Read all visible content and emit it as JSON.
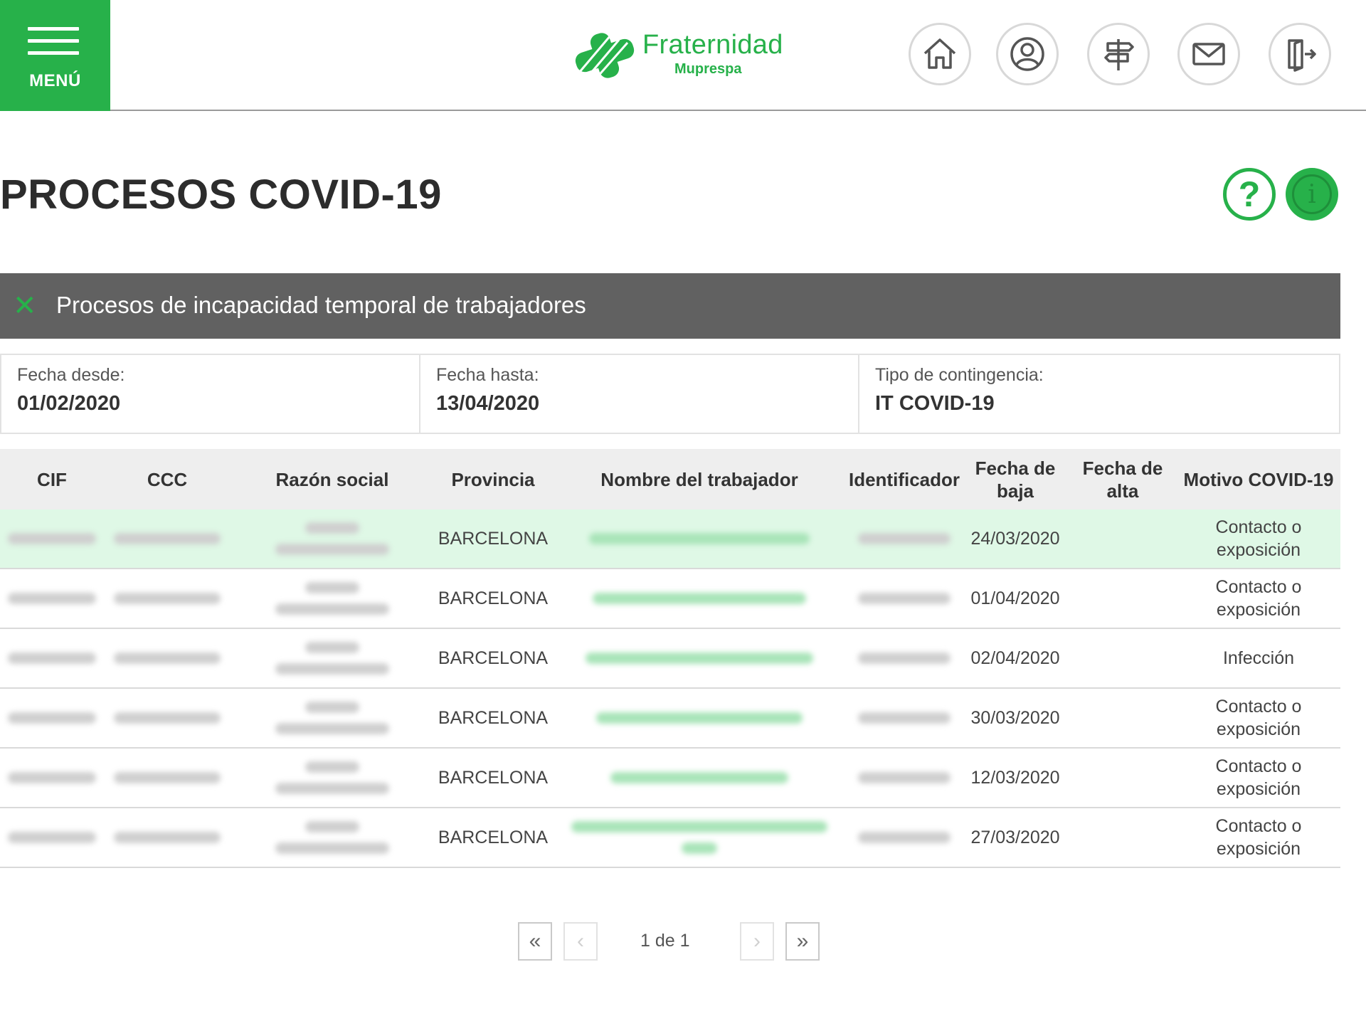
{
  "header": {
    "menu_label": "MENÚ",
    "logo_name": "Fraternidad",
    "logo_sub": "Muprespa",
    "brand_color": "#27b14a",
    "icons": [
      "home-icon",
      "user-icon",
      "signpost-icon",
      "mail-icon",
      "logout-icon"
    ]
  },
  "page": {
    "title": "PROCESOS COVID-19",
    "help_symbol": "?",
    "info_symbol": "i"
  },
  "section": {
    "close_symbol": "✕",
    "title": "Procesos de incapacidad temporal de trabajadores"
  },
  "filters": {
    "fecha_desde_label": "Fecha desde:",
    "fecha_desde_value": "01/02/2020",
    "fecha_hasta_label": "Fecha hasta:",
    "fecha_hasta_value": "13/04/2020",
    "tipo_label": "Tipo de contingencia:",
    "tipo_value": "IT COVID-19"
  },
  "table": {
    "columns": [
      "CIF",
      "CCC",
      "Razón social",
      "Provincia",
      "Nombre del trabajador",
      "Identificador",
      "Fecha de baja",
      "Fecha de alta",
      "Motivo COVID-19"
    ],
    "rows": [
      {
        "provincia": "BARCELONA",
        "fecha_baja": "24/03/2020",
        "fecha_alta": "",
        "motivo": "Contacto o exposición"
      },
      {
        "provincia": "BARCELONA",
        "fecha_baja": "01/04/2020",
        "fecha_alta": "",
        "motivo": "Contacto o exposición"
      },
      {
        "provincia": "BARCELONA",
        "fecha_baja": "02/04/2020",
        "fecha_alta": "",
        "motivo": "Infección"
      },
      {
        "provincia": "BARCELONA",
        "fecha_baja": "30/03/2020",
        "fecha_alta": "",
        "motivo": "Contacto o exposición"
      },
      {
        "provincia": "BARCELONA",
        "fecha_baja": "12/03/2020",
        "fecha_alta": "",
        "motivo": "Contacto o exposición"
      },
      {
        "provincia": "BARCELONA",
        "fecha_baja": "27/03/2020",
        "fecha_alta": "",
        "motivo": "Contacto o exposición"
      }
    ]
  },
  "pagination": {
    "first": "«",
    "prev": "‹",
    "info": "1 de 1",
    "next": "›",
    "last": "»"
  }
}
